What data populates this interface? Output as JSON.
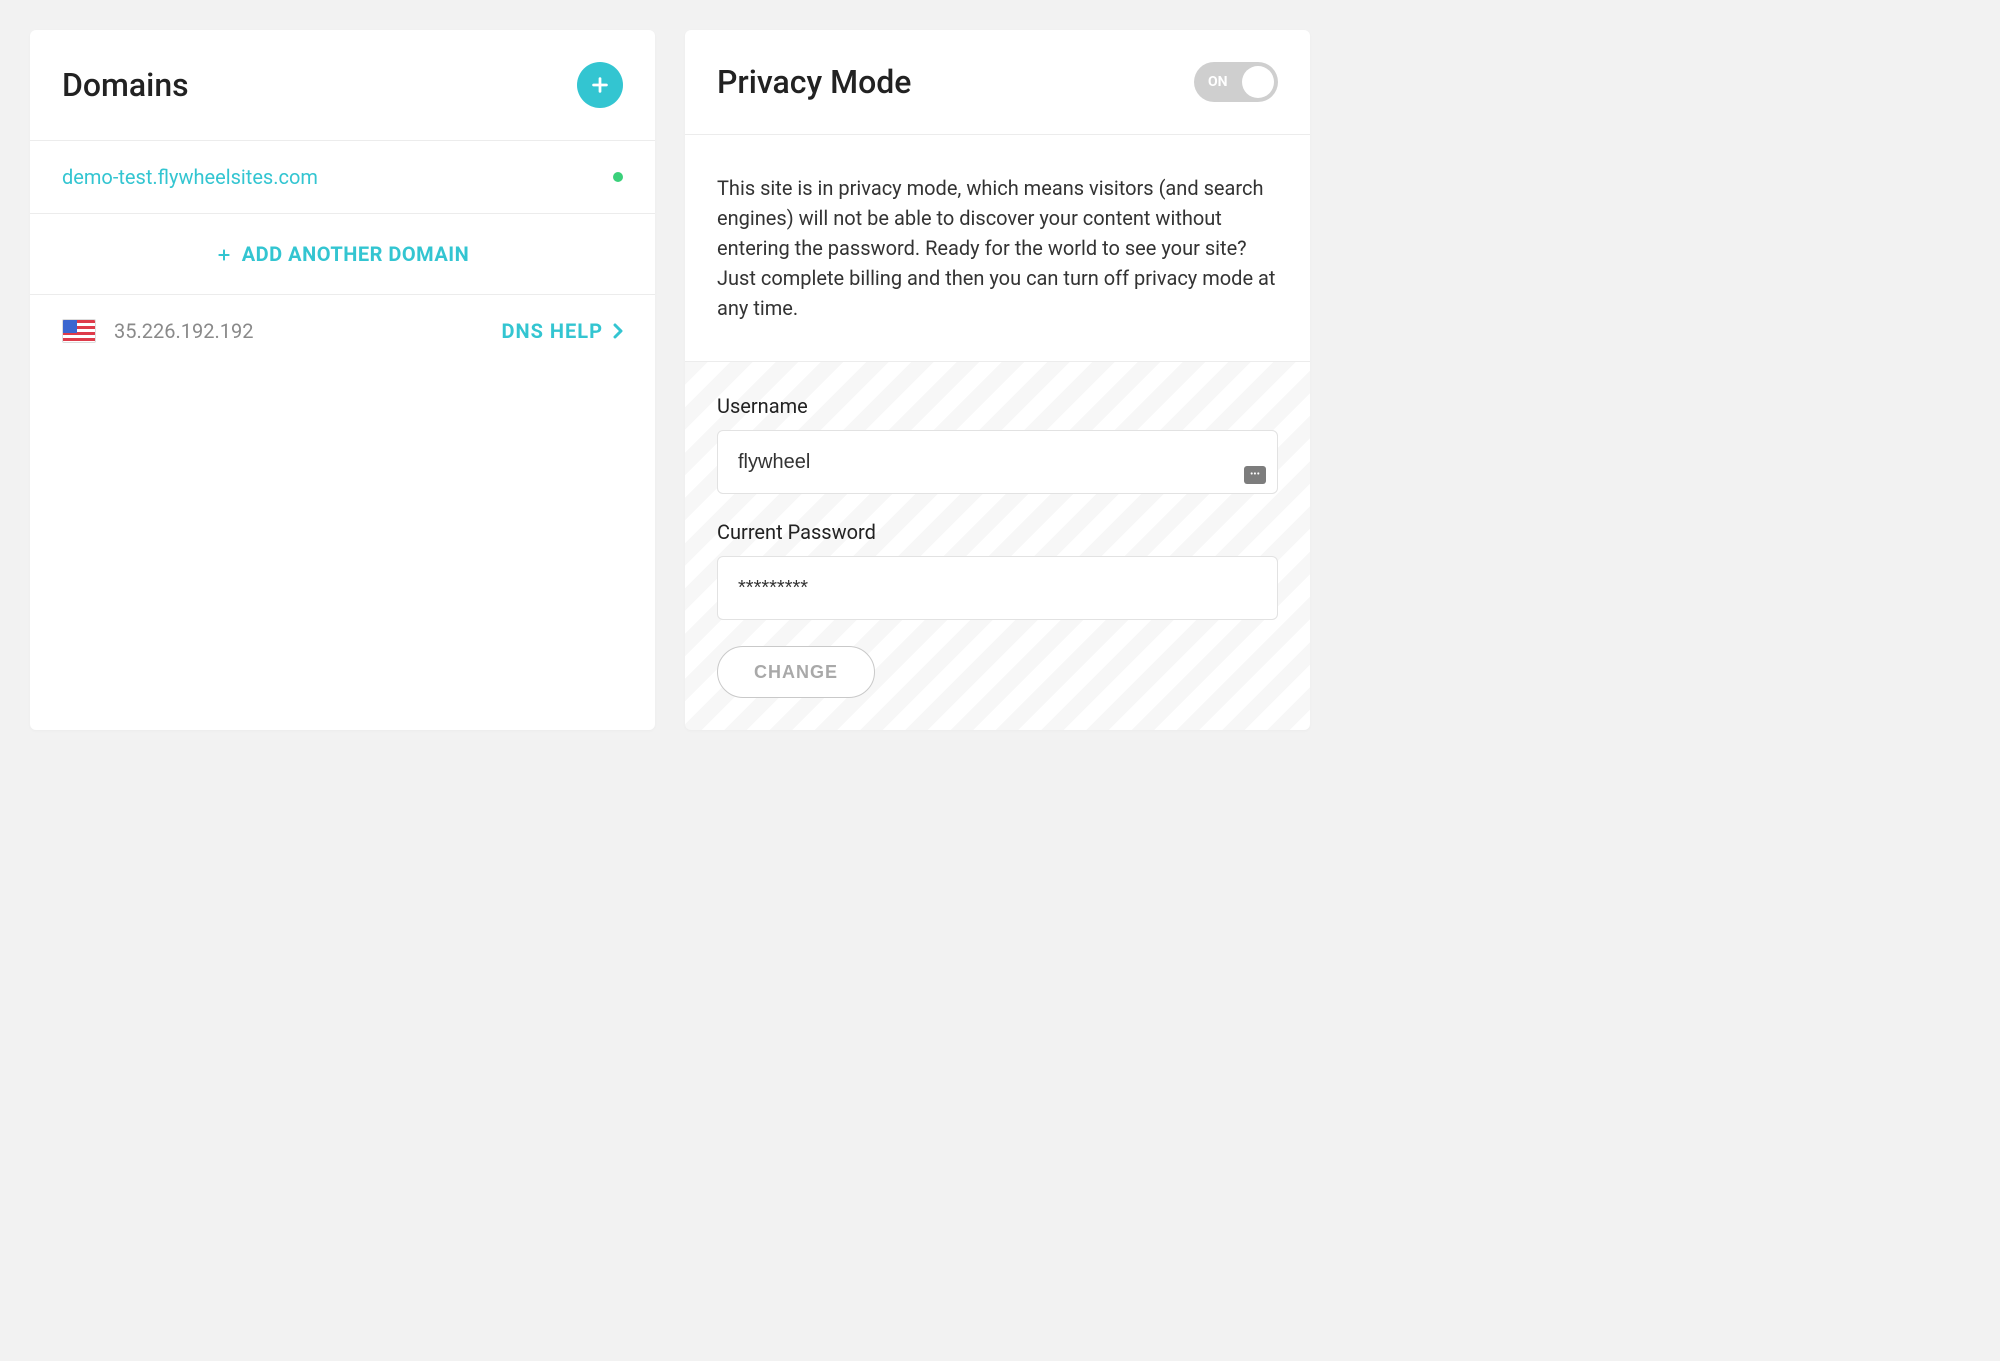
{
  "domains": {
    "title": "Domains",
    "list": [
      {
        "url": "demo-test.flywheelsites.com",
        "status": "active"
      }
    ],
    "add_label": "ADD ANOTHER DOMAIN",
    "ip": "35.226.192.192",
    "dns_help_label": "DNS HELP"
  },
  "privacy": {
    "title": "Privacy Mode",
    "toggle_state": "ON",
    "description": "This site is in privacy mode, which means visitors (and search engines) will not be able to discover your content without entering the password. Ready for the world to see your site? Just complete billing and then you can turn off privacy mode at any time.",
    "username_label": "Username",
    "username_value": "flywheel",
    "password_label": "Current Password",
    "password_value": "*********",
    "change_label": "CHANGE"
  }
}
